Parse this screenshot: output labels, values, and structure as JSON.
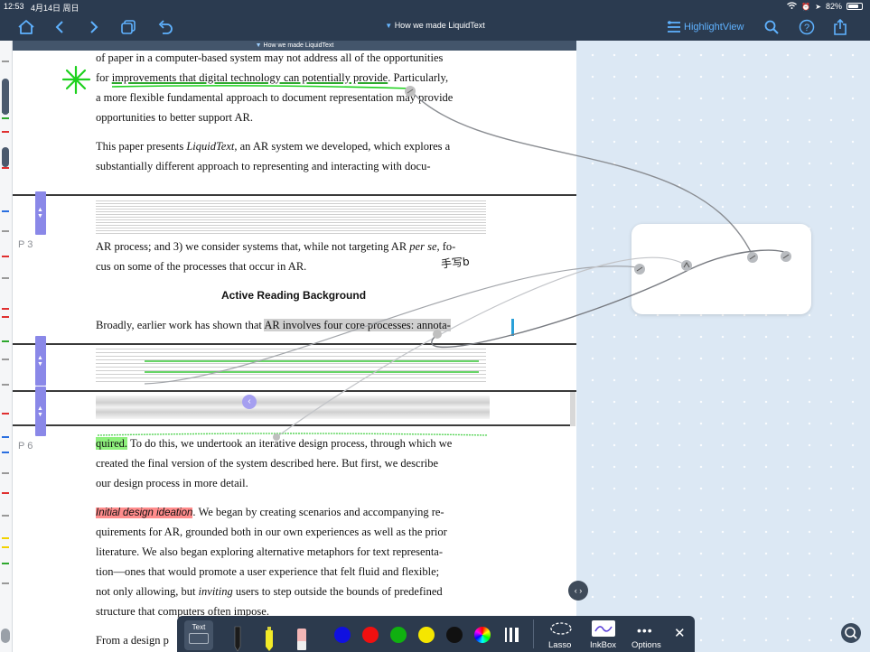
{
  "status": {
    "time": "12:53",
    "date": "4月14日 周日",
    "battery": "82%",
    "battery_level": 0.82
  },
  "nav": {
    "doc_title": "How we made LiquidText",
    "highlight_view": "HighlightView"
  },
  "doc": {
    "header": "How we made LiquidText",
    "heading": "Active Reading Background",
    "page_labels": [
      "P 3",
      "P 6"
    ],
    "lines": [
      "of paper in a computer-based system may not address all of the opportunities",
      "for improvements that digital technology can potentially provide. Particularly,",
      "a more flexible fundamental approach to document representation may provide",
      "opportunities to better support AR.",
      "This paper presents LiquidText, an AR system we developed, which explores a",
      "substantially different approach to representing and interacting with docu-",
      "AR process; and 3) we consider systems that, while not targeting AR per se, fo-",
      "cus on some of the processes that occur in AR.",
      "Broadly, earlier work has shown that AR involves four core processes: annota-",
      "quired. To do this, we undertook an iterative design process, through which we",
      "created the final version of the system described here. But first, we describe",
      "our design process in more detail.",
      "Initial design ideation. We began by creating scenarios and accompanying re-",
      "quirements for AR, grounded both in our own experiences as well as the prior",
      "literature. We also began exploring alternative metaphors for text representa-",
      "tion—ones that would promote a user experience that felt fluid and flexible;",
      "not only allowing, but inviting users to step outside the bounds of predefined",
      "structure that computers often impose.",
      "From a design p"
    ],
    "spans": {
      "l2_pre": "for ",
      "l2_ul": "improvements that digital technology can potentially provide",
      "l2_post": ". Particularly,",
      "l5_pre": "This paper presents ",
      "l5_em": "LiquidText",
      "l5_post": ", an AR system we developed, which explores a",
      "l7_pre": "AR process; and 3) we consider systems that, while not targeting AR ",
      "l7_em": "per se",
      "l7_post": ", fo-",
      "l9_pre": "Broadly, earlier work has shown that ",
      "l9_hl": "AR involves four core processes: annota-",
      "l10_hl": "quired.",
      "l10_post": " To do this, we undertook an iterative design process, through which we",
      "l13_hl": "Initial design ideation",
      "l13_post": ". We began by creating scenarios and accompanying re-",
      "l17_pre": "not only allowing, but ",
      "l17_em": "inviting",
      "l17_post": " users to step outside the bounds of predefined"
    },
    "handwriting": "手写b"
  },
  "toolbar": {
    "text_tool": "Text",
    "lasso": "Lasso",
    "inkbox": "InkBox",
    "options": "Options",
    "colors": [
      "#1010e0",
      "#f01010",
      "#10b010",
      "#f5e600",
      "#111111"
    ]
  },
  "colors": {
    "accent": "#5fb2ff",
    "chrome": "#2b3b50",
    "workspace": "#dce8f4"
  }
}
